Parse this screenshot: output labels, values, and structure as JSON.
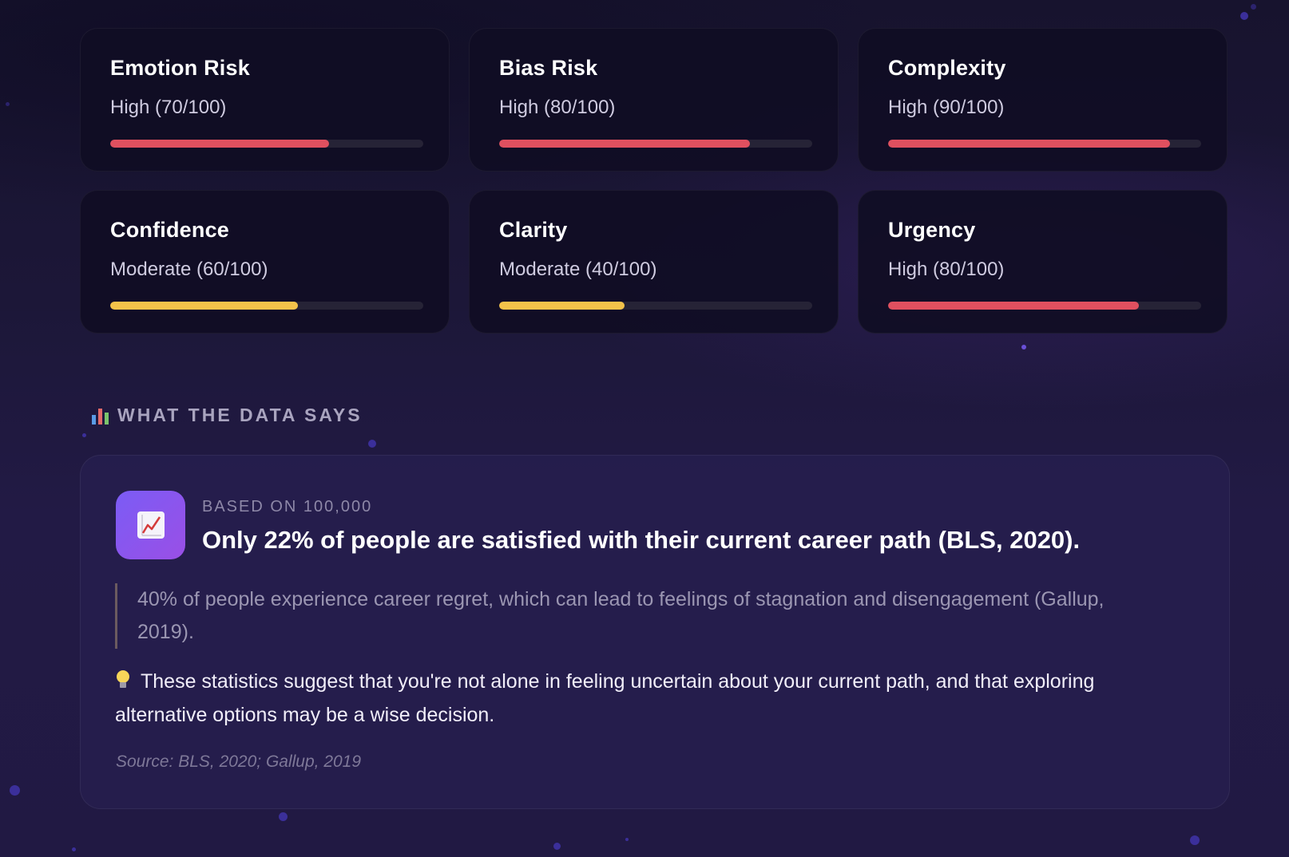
{
  "metrics": [
    {
      "title": "Emotion Risk",
      "value_text": "High (70/100)",
      "score": 70,
      "max": 100,
      "color": "#e0505f"
    },
    {
      "title": "Bias Risk",
      "value_text": "High (80/100)",
      "score": 80,
      "max": 100,
      "color": "#e0505f"
    },
    {
      "title": "Complexity",
      "value_text": "High (90/100)",
      "score": 90,
      "max": 100,
      "color": "#e0505f"
    },
    {
      "title": "Confidence",
      "value_text": "Moderate (60/100)",
      "score": 60,
      "max": 100,
      "color": "#f3c24a"
    },
    {
      "title": "Clarity",
      "value_text": "Moderate (40/100)",
      "score": 40,
      "max": 100,
      "color": "#f3c24a"
    },
    {
      "title": "Urgency",
      "value_text": "High (80/100)",
      "score": 80,
      "max": 100,
      "color": "#e0505f"
    }
  ],
  "data_section": {
    "icon": "bar-chart-icon",
    "title": "WHAT THE DATA SAYS"
  },
  "data_card": {
    "icon": "chart-increasing-icon",
    "meta": "BASED ON 100,000",
    "headline": "Only 22% of people are satisfied with their current career path (BLS, 2020).",
    "quote": "40% of people experience career regret, which can lead to feelings of stagnation and disengagement (Gallup, 2019).",
    "insight_icon": "light-bulb-icon",
    "insight": "These statistics suggest that you're not alone in feeling uncertain about your current path, and that exploring alternative options may be a wise decision.",
    "source": "Source: BLS, 2020; Gallup, 2019"
  },
  "colors": {
    "high": "#e0505f",
    "moderate": "#f3c24a",
    "accent": "#7b5cf5"
  }
}
